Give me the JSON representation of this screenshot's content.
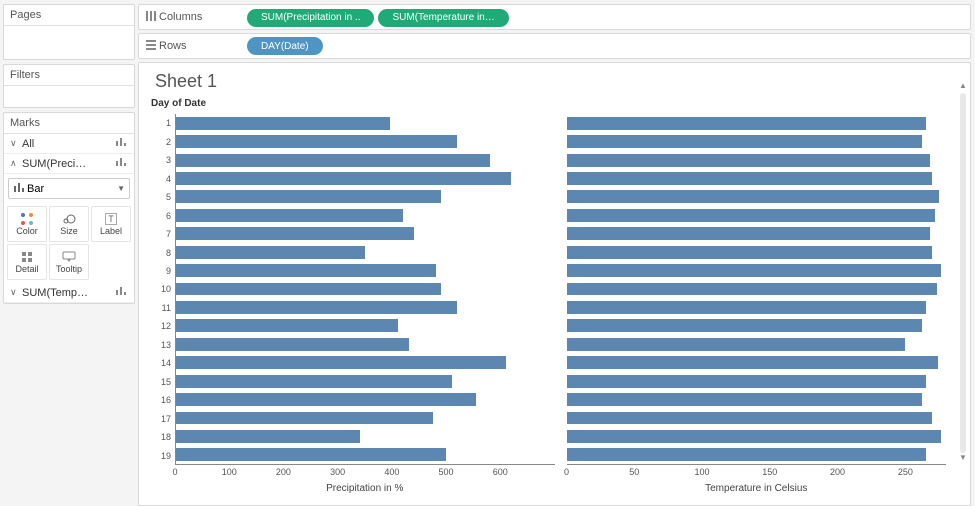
{
  "sidebar": {
    "pages_label": "Pages",
    "filters_label": "Filters",
    "marks_label": "Marks",
    "marks_rows": [
      {
        "chev": "∨",
        "label": "All"
      },
      {
        "chev": "∧",
        "label": "SUM(Preci…"
      }
    ],
    "mark_type": "Bar",
    "mark_buttons": [
      {
        "name": "color-button",
        "label": "Color",
        "icon": "dots"
      },
      {
        "name": "size-button",
        "label": "Size",
        "icon": "size"
      },
      {
        "name": "label-button",
        "label": "Label",
        "icon": "T"
      },
      {
        "name": "detail-button",
        "label": "Detail",
        "icon": "detail"
      },
      {
        "name": "tooltip-button",
        "label": "Tooltip",
        "icon": "tooltip"
      }
    ],
    "marks_rows2": [
      {
        "chev": "∨",
        "label": "SUM(Temp…"
      }
    ]
  },
  "shelves": {
    "columns_label": "Columns",
    "rows_label": "Rows",
    "column_pills": [
      "SUM(Precipitation in ..",
      "SUM(Temperature in…"
    ],
    "row_pill": "DAY(Date)"
  },
  "sheet": {
    "title": "Sheet 1",
    "ylabel": "Day of Date"
  },
  "chart_data": {
    "type": "bar",
    "categories": [
      1,
      2,
      3,
      4,
      5,
      6,
      7,
      8,
      9,
      10,
      11,
      12,
      13,
      14,
      15,
      16,
      17,
      18,
      19
    ],
    "series": [
      {
        "name": "Precipitation in %",
        "values": [
          395,
          520,
          580,
          620,
          490,
          420,
          440,
          350,
          480,
          490,
          520,
          410,
          430,
          610,
          510,
          555,
          475,
          340,
          500
        ],
        "xlim": [
          0,
          700
        ],
        "ticks": [
          0,
          100,
          200,
          300,
          400,
          500,
          600
        ]
      },
      {
        "name": "Temperature in Celsius",
        "values": [
          265,
          262,
          268,
          270,
          275,
          272,
          268,
          270,
          276,
          273,
          265,
          262,
          250,
          274,
          265,
          262,
          270,
          276,
          265
        ],
        "xlim": [
          0,
          280
        ],
        "ticks": [
          0,
          50,
          100,
          150,
          200,
          250
        ]
      }
    ],
    "xlabel": "",
    "title": "Sheet 1"
  }
}
